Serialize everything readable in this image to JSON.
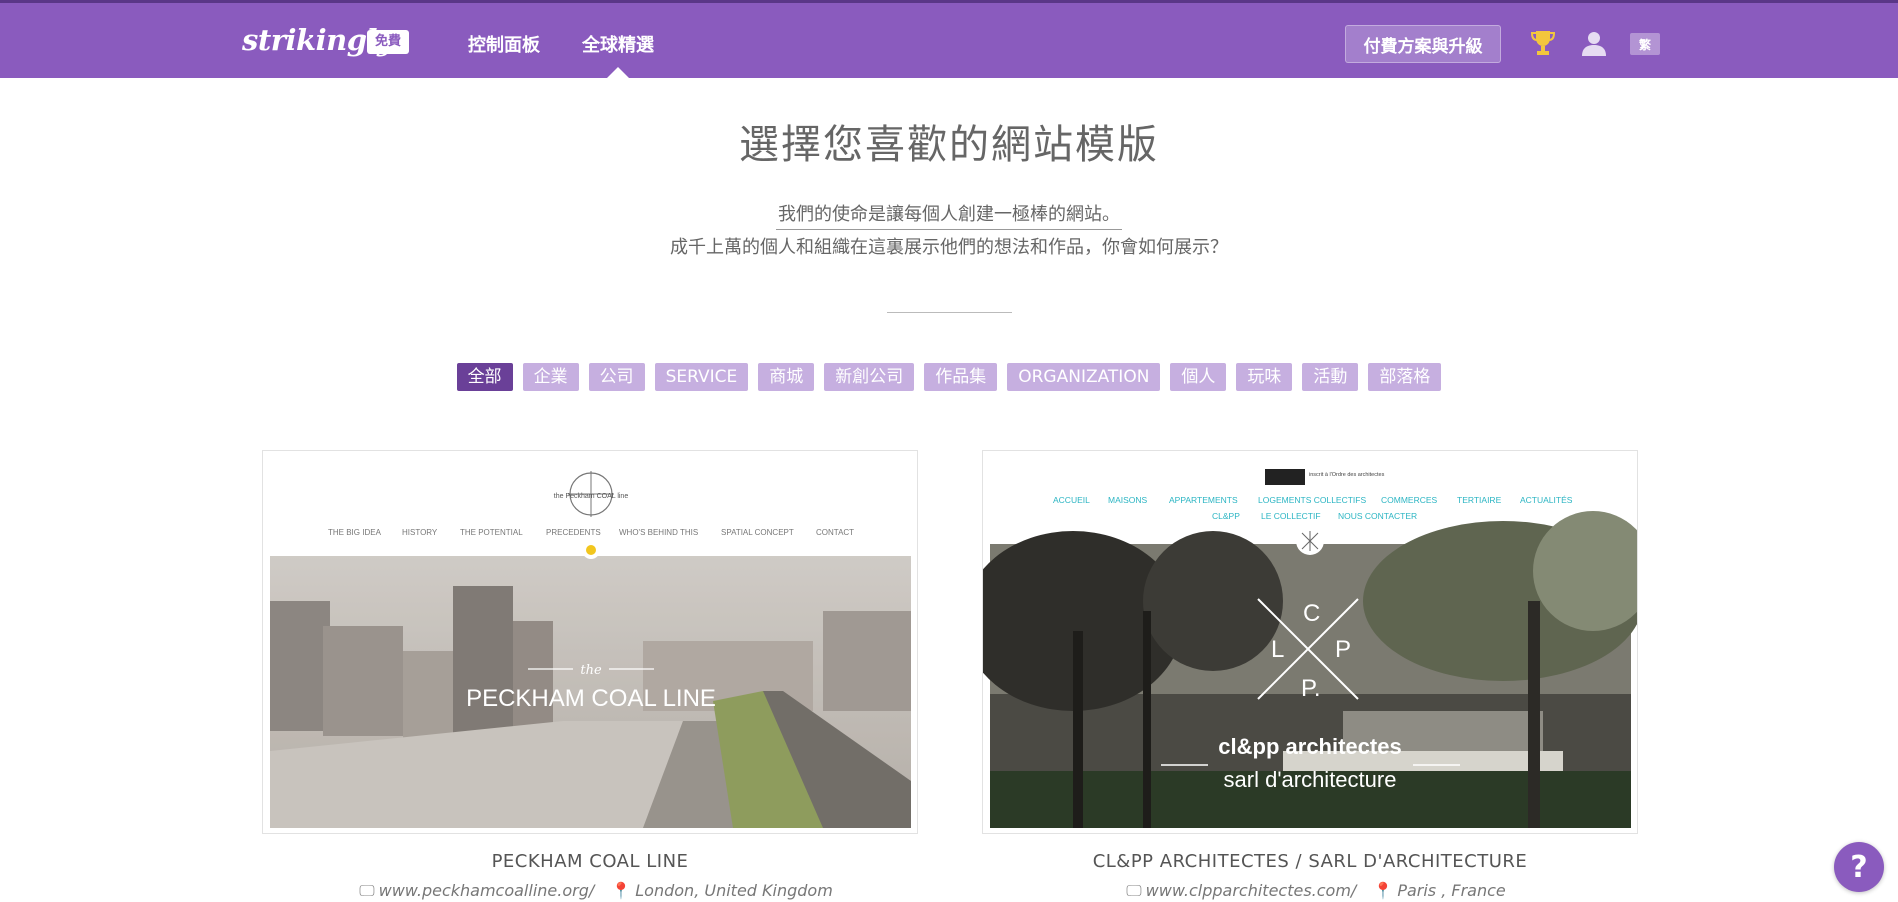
{
  "header": {
    "logo": "strikingly",
    "plan_badge": "免費",
    "nav": [
      "控制面板",
      "全球精選"
    ],
    "upgrade_label": "付費方案與升級",
    "lang_label": "繁",
    "brand_color": "#8a5bbe"
  },
  "main": {
    "title": "選擇您喜歡的網站模版",
    "mission": "我們的使命是讓每個人創建一極棒的網站。",
    "subtitle": "成千上萬的個人和組織在這裏展示他們的想法和作品，你會如何展示？"
  },
  "filters": {
    "active": "全部",
    "items": [
      "全部",
      "企業",
      "公司",
      "SERVICE",
      "商城",
      "新創公司",
      "作品集",
      "ORGANIZATION",
      "個人",
      "玩味",
      "活動",
      "部落格"
    ]
  },
  "cards": [
    {
      "title": "PECKHAM COAL LINE",
      "url": "www.peckhamcoalline.org/",
      "location": "London, United Kingdom",
      "preview": {
        "logo_text": "the Peckham COAL line",
        "nav": [
          "THE BIG IDEA",
          "HISTORY",
          "THE POTENTIAL",
          "PRECEDENTS",
          "WHO'S BEHIND THIS",
          "SPATIAL CONCEPT",
          "CONTACT"
        ],
        "hero_small": "the",
        "hero_title": "PECKHAM COAL LINE"
      }
    },
    {
      "title": "CL&PP ARCHITECTES / SARL D'ARCHITECTURE",
      "url": "www.clpparchitectes.com/",
      "location": "Paris , France",
      "preview": {
        "logo_text": "inscrit à l'Ordre des architectes",
        "nav_row1": [
          "ACCUEIL",
          "MAISONS",
          "APPARTEMENTS",
          "LOGEMENTS COLLECTIFS",
          "COMMERCES",
          "TERTIAIRE",
          "ACTUALITÉS"
        ],
        "nav_row2": [
          "CL&PP",
          "LE COLLECTIF",
          "NOUS CONTACTER"
        ],
        "monogram": [
          "C",
          "L",
          "P",
          "P."
        ],
        "hero_line1": "cl&pp architectes",
        "hero_line2": "sarl d'architecture"
      }
    }
  ],
  "help_label": "?"
}
